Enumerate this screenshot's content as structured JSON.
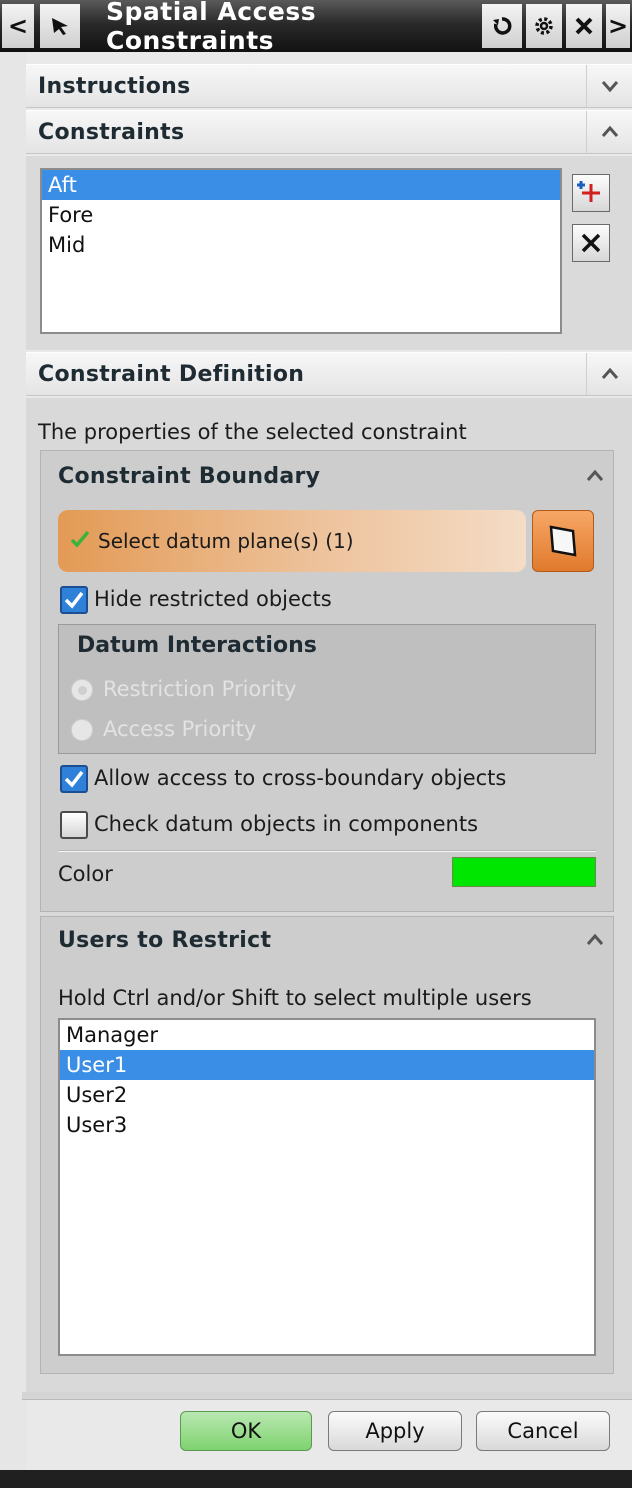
{
  "window": {
    "title": "Spatial Access Constraints",
    "back_glyph": "<",
    "forward_glyph": ">"
  },
  "sections": {
    "instructions": {
      "label": "Instructions",
      "expanded": false
    },
    "constraints": {
      "label": "Constraints",
      "items": [
        "Aft",
        "Fore",
        "Mid"
      ],
      "selected_index": 0
    },
    "constraint_definition": {
      "label": "Constraint Definition",
      "description": "The properties of the selected constraint",
      "boundary": {
        "label": "Constraint Boundary",
        "select_label": "Select datum plane(s) (1)",
        "hide_restricted": {
          "label": "Hide restricted objects",
          "checked": true
        },
        "datum_interactions": {
          "label": "Datum Interactions",
          "options": [
            "Restriction Priority",
            "Access Priority"
          ],
          "selected_index": 0,
          "enabled": false
        },
        "allow_cross_boundary": {
          "label": "Allow access to cross-boundary objects",
          "checked": true
        },
        "check_components": {
          "label": "Check datum objects in components",
          "checked": false
        },
        "color_label": "Color",
        "color_value": "#00e600"
      },
      "users": {
        "label": "Users to Restrict",
        "hint": "Hold Ctrl and/or Shift to select multiple users",
        "items": [
          "Manager",
          "User1",
          "User2",
          "User3"
        ],
        "selected_index": 1
      }
    }
  },
  "footer": {
    "ok_label": "OK",
    "apply_label": "Apply",
    "cancel_label": "Cancel"
  },
  "colors": {
    "selection": "#3b8ee6",
    "ok_button": "#8fd87f",
    "select_row_accent": "#e39a55"
  }
}
